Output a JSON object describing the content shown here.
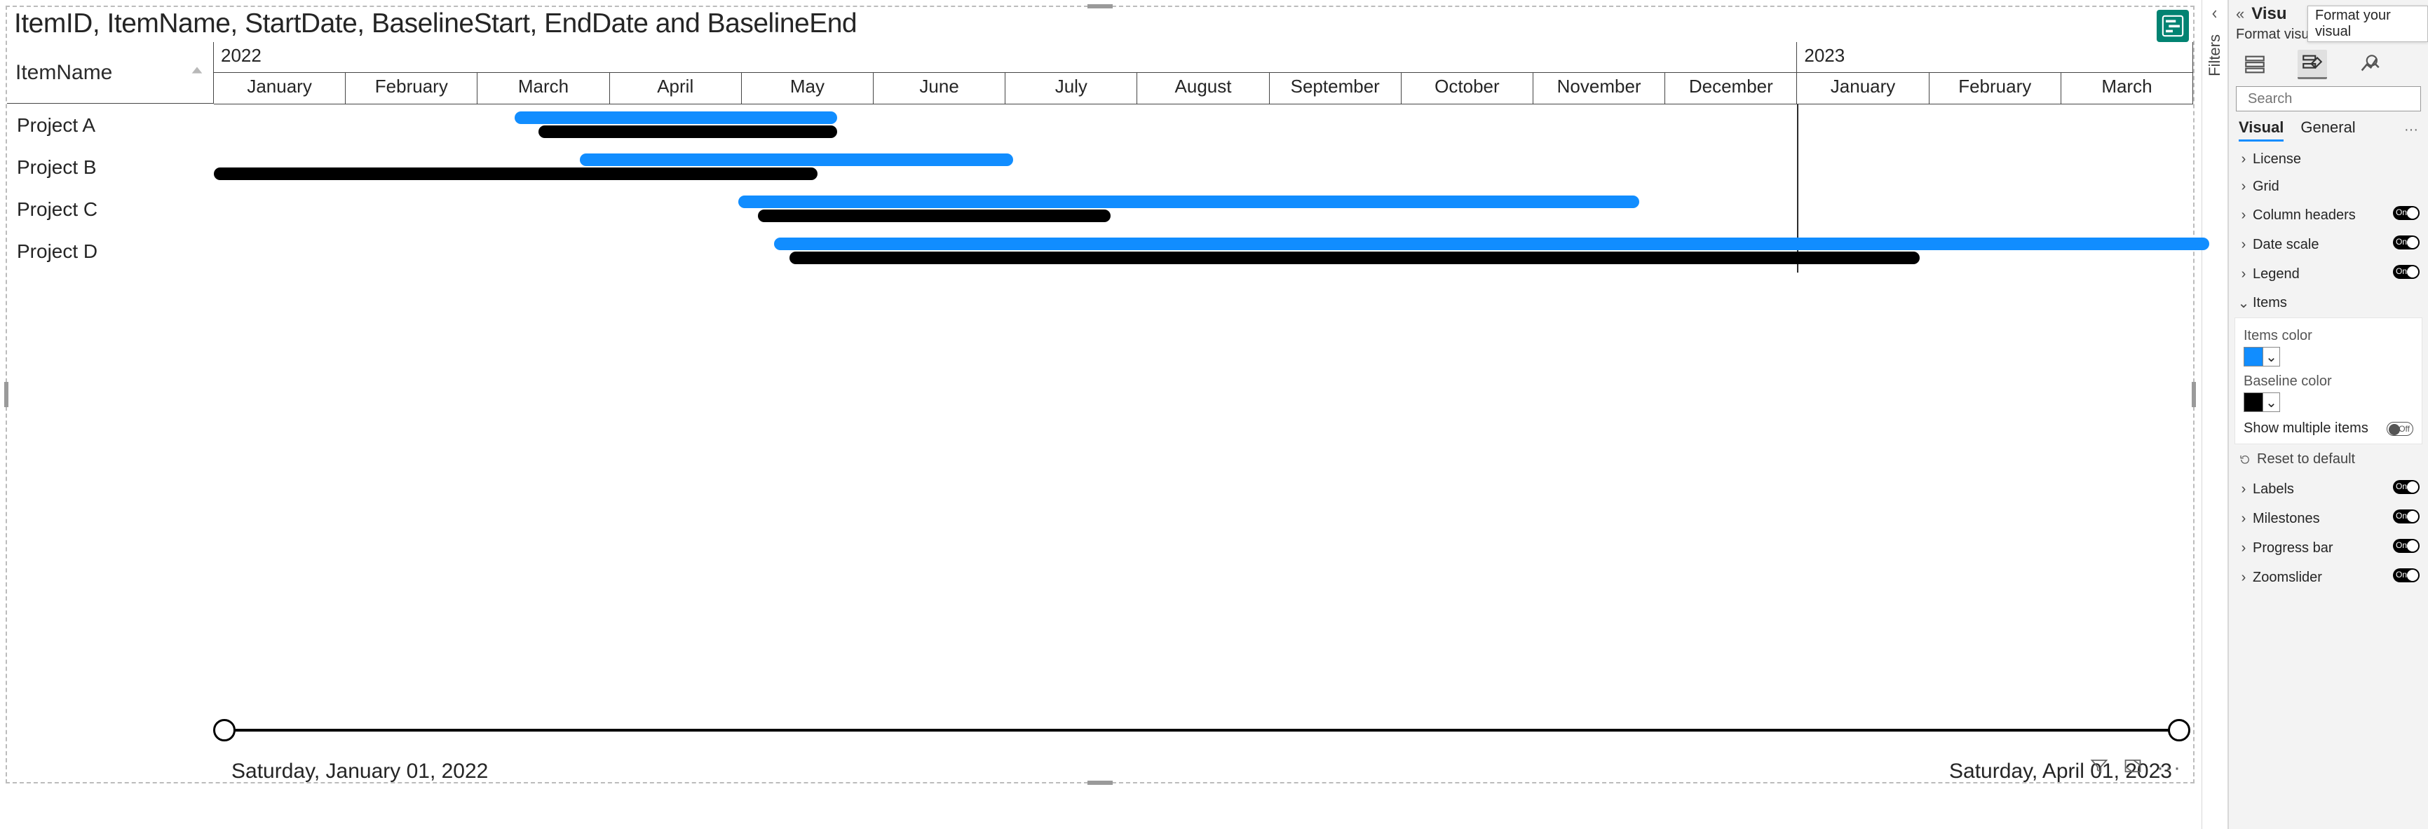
{
  "visual": {
    "title": "ItemID, ItemName, StartDate, BaselineStart, EndDate and BaselineEnd",
    "row_header": "ItemName",
    "timeline": {
      "years": [
        {
          "label": "2022",
          "widthPct": 80
        },
        {
          "label": "2023",
          "widthPct": 20
        }
      ],
      "months": [
        {
          "label": "January",
          "widthPct": 6.667
        },
        {
          "label": "February",
          "widthPct": 6.667
        },
        {
          "label": "March",
          "widthPct": 6.667
        },
        {
          "label": "April",
          "widthPct": 6.667
        },
        {
          "label": "May",
          "widthPct": 6.667
        },
        {
          "label": "June",
          "widthPct": 6.667
        },
        {
          "label": "July",
          "widthPct": 6.667
        },
        {
          "label": "August",
          "widthPct": 6.667
        },
        {
          "label": "September",
          "widthPct": 6.667
        },
        {
          "label": "October",
          "widthPct": 6.667
        },
        {
          "label": "November",
          "widthPct": 6.667
        },
        {
          "label": "December",
          "widthPct": 6.667
        },
        {
          "label": "January",
          "widthPct": 6.667
        },
        {
          "label": "February",
          "widthPct": 6.667
        },
        {
          "label": "March",
          "widthPct": 6.667
        }
      ],
      "year_divider_pct": 80
    },
    "rows": [
      {
        "label": "Project A",
        "item_start_pct": 15.2,
        "item_width_pct": 16.3,
        "base_start_pct": 16.4,
        "base_width_pct": 15.1
      },
      {
        "label": "Project B",
        "item_start_pct": 18.5,
        "item_width_pct": 21.9,
        "base_start_pct": 0.0,
        "base_width_pct": 30.5
      },
      {
        "label": "Project C",
        "item_start_pct": 26.5,
        "item_width_pct": 45.5,
        "base_start_pct": 27.5,
        "base_width_pct": 17.8
      },
      {
        "label": "Project D",
        "item_start_pct": 28.3,
        "item_width_pct": 72.5,
        "base_start_pct": 29.1,
        "base_width_pct": 57.1
      }
    ],
    "zoom": {
      "start_label": "Saturday, January 01, 2022",
      "end_label": "Saturday, April 01, 2023"
    }
  },
  "filters_strip": {
    "label": "Filters"
  },
  "panel": {
    "title": "Visu",
    "tooltip": "Format your visual",
    "subtitle": "Format visual",
    "search_placeholder": "Search",
    "tabs": {
      "visual": "Visual",
      "general": "General"
    },
    "cards": {
      "license": {
        "label": "License"
      },
      "grid": {
        "label": "Grid"
      },
      "column_headers": {
        "label": "Column headers",
        "toggle": "On"
      },
      "date_scale": {
        "label": "Date scale",
        "toggle": "On"
      },
      "legend": {
        "label": "Legend",
        "toggle": "On"
      },
      "items": {
        "label": "Items",
        "items_color_label": "Items color",
        "items_color": "#118DFF",
        "baseline_color_label": "Baseline color",
        "baseline_color": "#000000",
        "show_multiple_label": "Show multiple items",
        "show_multiple_toggle": "Off"
      },
      "reset": {
        "label": "Reset to default"
      },
      "labels": {
        "label": "Labels",
        "toggle": "On"
      },
      "milestones": {
        "label": "Milestones",
        "toggle": "On"
      },
      "progress_bar": {
        "label": "Progress bar",
        "toggle": "On"
      },
      "zoomslider": {
        "label": "Zoomslider",
        "toggle": "On"
      }
    }
  },
  "chart_data": {
    "type": "gantt",
    "title": "ItemID, ItemName, StartDate, BaselineStart, EndDate and BaselineEnd",
    "x_range": [
      "2022-01-01",
      "2023-04-01"
    ],
    "tasks": [
      {
        "name": "Project A",
        "start": "2022-03-10",
        "end": "2022-05-22",
        "baseline_start": "2022-03-15",
        "baseline_end": "2022-05-25"
      },
      {
        "name": "Project B",
        "start": "2022-03-25",
        "end": "2022-07-05",
        "baseline_start": "2022-01-01",
        "baseline_end": "2022-05-20"
      },
      {
        "name": "Project C",
        "start": "2022-05-01",
        "end": "2022-11-25",
        "baseline_start": "2022-05-05",
        "baseline_end": "2022-07-25"
      },
      {
        "name": "Project D",
        "start": "2022-05-08",
        "end": "2023-04-01",
        "baseline_start": "2022-05-12",
        "baseline_end": "2023-01-25"
      }
    ],
    "colors": {
      "item": "#118DFF",
      "baseline": "#000000"
    }
  }
}
